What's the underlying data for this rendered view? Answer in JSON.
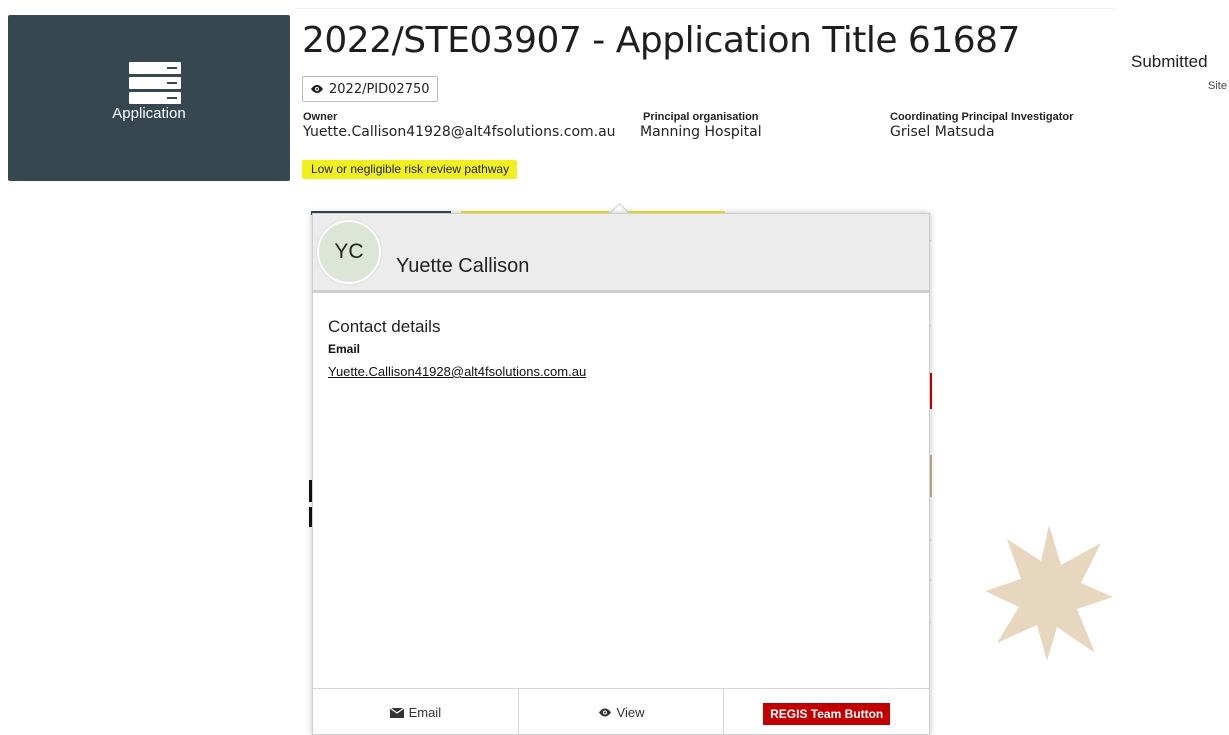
{
  "tile": {
    "label": "Application",
    "icon": "server-stack-icon"
  },
  "header": {
    "title": "2022/STE03907 - Application Title 61687",
    "project_id": "2022/PID02750",
    "owner_label": "Owner",
    "owner_value": "Yuette.Callison41928@alt4fsolutions.com.au",
    "org_label": "Principal organisation",
    "org_value": "Manning Hospital",
    "cpi_label": "Coordinating Principal Investigator",
    "cpi_value": "Grisel Matsuda",
    "pathway": "Low or negligible risk review pathway",
    "status": "Submitted",
    "status_sub": "Site"
  },
  "card": {
    "initials": "YC",
    "name": "Yuette Callison",
    "section_title": "Contact details",
    "email_label": "Email",
    "email_value": "Yuette.Callison41928@alt4fsolutions.com.au",
    "footer": {
      "email_label": "Email",
      "view_label": "View",
      "regis_label": "REGIS Team Button"
    }
  },
  "colors": {
    "tile_bg": "#37474f",
    "pathway_bg": "#f0f021",
    "regis_bg": "#c00000",
    "avatar_bg": "#dde6d6",
    "star": "#e7d7bf"
  }
}
